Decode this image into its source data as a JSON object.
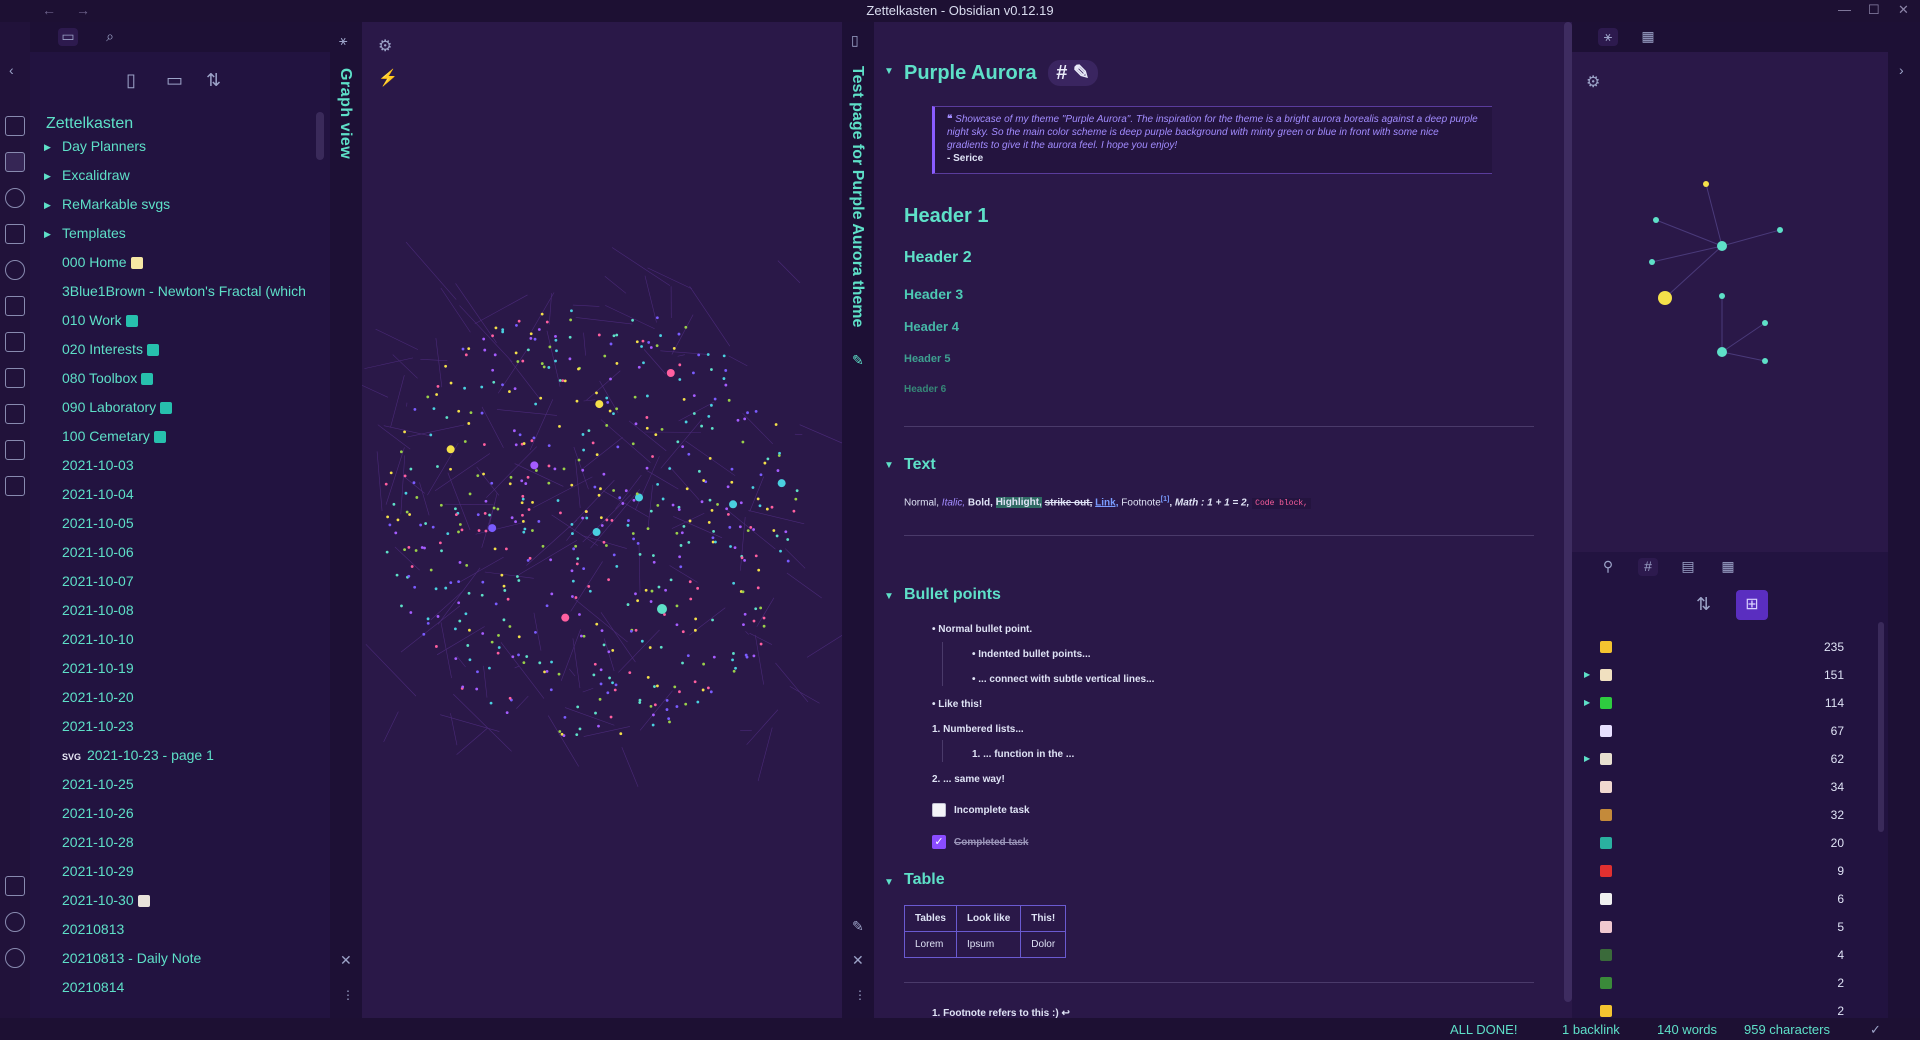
{
  "window": {
    "title": "Zettelkasten - Obsidian v0.12.19"
  },
  "vault": {
    "name": "Zettelkasten"
  },
  "file_tree": [
    {
      "label": "Day Planners",
      "folder": true
    },
    {
      "label": "Excalidraw",
      "folder": true
    },
    {
      "label": "ReMarkable svgs",
      "folder": true
    },
    {
      "label": "Templates",
      "folder": true
    },
    {
      "label": "000 Home",
      "emoji": "#f6e7a4"
    },
    {
      "label": "3Blue1Brown - Newton's Fractal (which"
    },
    {
      "label": "010 Work",
      "emoji": "#27c0ad"
    },
    {
      "label": "020 Interests",
      "emoji": "#27c0ad"
    },
    {
      "label": "080 Toolbox",
      "emoji": "#27c0ad"
    },
    {
      "label": "090 Laboratory",
      "emoji": "#27c0ad"
    },
    {
      "label": "100 Cemetary",
      "emoji": "#27c0ad"
    },
    {
      "label": "2021-10-03"
    },
    {
      "label": "2021-10-04"
    },
    {
      "label": "2021-10-05"
    },
    {
      "label": "2021-10-06"
    },
    {
      "label": "2021-10-07"
    },
    {
      "label": "2021-10-08"
    },
    {
      "label": "2021-10-10"
    },
    {
      "label": "2021-10-19"
    },
    {
      "label": "2021-10-20"
    },
    {
      "label": "2021-10-23"
    },
    {
      "label": "2021-10-23 - page 1",
      "svg": "SVG"
    },
    {
      "label": "2021-10-25"
    },
    {
      "label": "2021-10-26"
    },
    {
      "label": "2021-10-28"
    },
    {
      "label": "2021-10-29"
    },
    {
      "label": "2021-10-30",
      "emoji": "#e9e2da"
    },
    {
      "label": "20210813"
    },
    {
      "label": "20210813 - Daily Note"
    },
    {
      "label": "20210814"
    }
  ],
  "graph": {
    "label": "Graph view"
  },
  "note": {
    "side_title": "Test page for Purple Aurora theme",
    "title": "Purple Aurora",
    "title_tag": "#",
    "quote": "Showcase of my theme \"Purple Aurora\". The inspiration for the theme is a bright aurora borealis against a deep purple night sky. So the main color scheme is deep purple background with minty green or blue in front with some nice gradients to give it the aurora feel. I hope you enjoy!",
    "quote_author": "- Serice",
    "h1": "Header 1",
    "h2": "Header 2",
    "h3": "Header 3",
    "h4": "Header 4",
    "h5": "Header 5",
    "h6": "Header 6",
    "text_heading": "Text",
    "text_line": {
      "normal": "Normal,",
      "italic": "Italic,",
      "bold": "Bold,",
      "highlight": "Highlight,",
      "strike": "strike out,",
      "link": "Link,",
      "footnote": "Footnote",
      "footnote_ref": "[1]",
      "math": "Math : 1 + 1 = 2,",
      "code": "Code block,"
    },
    "bullets_heading": "Bullet points",
    "bullets": {
      "b1": "Normal bullet point.",
      "b2": "Indented bullet points...",
      "b3": "... connect with subtle vertical lines...",
      "b4": "Like this!",
      "n1": "1. Numbered lists...",
      "n2": "1. ... function in the ...",
      "n3": "2. ... same way!"
    },
    "tasks": {
      "incomplete": "Incomplete task",
      "completed": "Completed task"
    },
    "table_heading": "Table",
    "table": {
      "headers": [
        "Tables",
        "Look like",
        "This!"
      ],
      "rows": [
        [
          "Lorem",
          "Ipsum",
          "Dolor"
        ]
      ]
    },
    "footnote": "1. Footnote refers to this :) ↩"
  },
  "tag_pane": {
    "counts": [
      235,
      151,
      114,
      67,
      62,
      34,
      32,
      20,
      9,
      6,
      5,
      4,
      2,
      2
    ],
    "emoji_colors": [
      "#f4c430",
      "#f0e0c0",
      "#2ecc40",
      "#e8e0ff",
      "#e8e0d0",
      "#f0d8d0",
      "#c48a3a",
      "#2ab0a0",
      "#e03030",
      "#f0f0f0",
      "#f0c8d0",
      "#3a6a3a",
      "#3a8a3a",
      "#f4c430"
    ]
  },
  "status": {
    "message": "ALL DONE!",
    "backlinks": "1 backlink",
    "words": "140 words",
    "chars": "959 characters"
  },
  "colors": {
    "accent": "#5ee0c8",
    "background": "#2a1848",
    "purple": "#8a5cff"
  }
}
